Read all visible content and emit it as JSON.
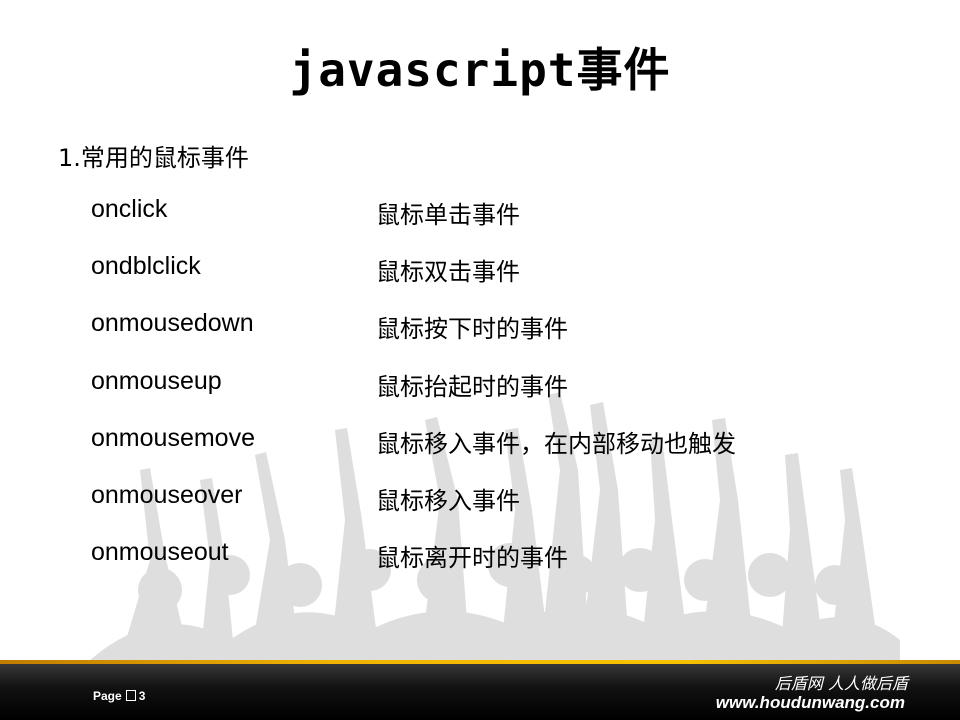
{
  "slide": {
    "title": "javascript事件",
    "heading": "1.常用的鼠标事件",
    "events": [
      {
        "name": "onclick",
        "desc": "鼠标单击事件"
      },
      {
        "name": "ondblclick",
        "desc": "鼠标双击事件"
      },
      {
        "name": "onmousedown",
        "desc": "鼠标按下时的事件"
      },
      {
        "name": "onmouseup",
        "desc": "鼠标抬起时的事件"
      },
      {
        "name": "onmousemove",
        "desc": "鼠标移入事件，在内部移动也触发"
      },
      {
        "name": "onmouseover",
        "desc": "鼠标移入事件"
      },
      {
        "name": "onmouseout",
        "desc": "鼠标离开时的事件"
      }
    ]
  },
  "footer": {
    "page_word": "Page",
    "page_number": "3",
    "brand_slogan": "后盾网 人人做后盾",
    "brand_url": "www.houdunwang.com"
  },
  "colors": {
    "accent_line": "#f2b300",
    "footer_bg": "#111111",
    "crowd_silhouette": "#dedede"
  }
}
